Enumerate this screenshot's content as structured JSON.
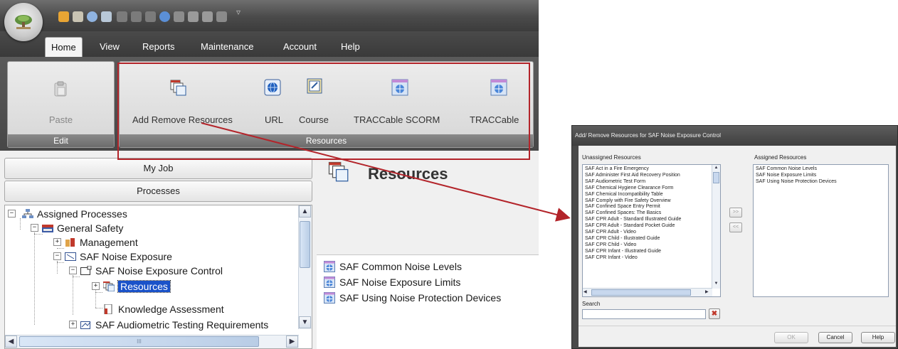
{
  "app": {
    "tabs": [
      "Home",
      "View",
      "Reports",
      "Maintenance",
      "Account",
      "Help"
    ],
    "ribbon": {
      "edit_group": {
        "caption": "Edit",
        "paste_label": "Paste"
      },
      "resources_group": {
        "caption": "Resources",
        "buttons": [
          "Add Remove Resources",
          "URL",
          "Course",
          "TRACCable SCORM",
          "TRACCable"
        ]
      }
    },
    "panels": {
      "my_job": "My Job",
      "processes": "Processes"
    },
    "tree": {
      "nodes": [
        "Assigned Processes",
        "General Safety",
        "Management",
        "SAF  Noise Exposure",
        "SAF  Noise Exposure Control",
        "Resources",
        "Knowledge Assessment",
        "SAF  Audiometric Testing Requirements"
      ],
      "selected": "Resources",
      "hscroll_grip": "III"
    },
    "content": {
      "title": "Resources",
      "items": [
        "SAF  Common Noise Levels",
        "SAF  Noise Exposure Limits",
        "SAF  Using Noise Protection Devices"
      ]
    }
  },
  "dialog": {
    "title": "Add/ Remove Resources for SAF  Noise Exposure Control",
    "unassigned_label": "Unassigned Resources",
    "assigned_label": "Assigned Resources",
    "unassigned": [
      "SAF  Act in a Fire Emergency",
      "SAF  Administer First Aid Recovery Position",
      "SAF  Audiometric Test Form",
      "SAF  Chemical Hygiene Clearance Form",
      "SAF  Chemical Incompatibility Table",
      "SAF  Comply with Fire Safety Overview",
      "SAF  Confined Space Entry Permit",
      "SAF  Confined Spaces: The Basics",
      "SAF  CPR Adult - Standard Illustrated Guide",
      "SAF  CPR Adult - Standard Pocket Guide",
      "SAF  CPR Adult - Video",
      "SAF  CPR Child - Illustrated Guide",
      "SAF  CPR Child - Video",
      "SAF  CPR Infant - Illustrated Guide",
      "SAF  CPR Infant - Video"
    ],
    "assigned": [
      "SAF  Common Noise Levels",
      "SAF  Noise Exposure Limits",
      "SAF  Using Noise Protection Devices"
    ],
    "move_right": ">>",
    "move_left": "<<",
    "search_label": "Search",
    "search_value": "",
    "buttons": {
      "ok": "OK",
      "cancel": "Cancel",
      "help": "Help"
    }
  },
  "colors": {
    "annotation_red": "#b3242a",
    "selection_blue": "#1a52c9"
  }
}
